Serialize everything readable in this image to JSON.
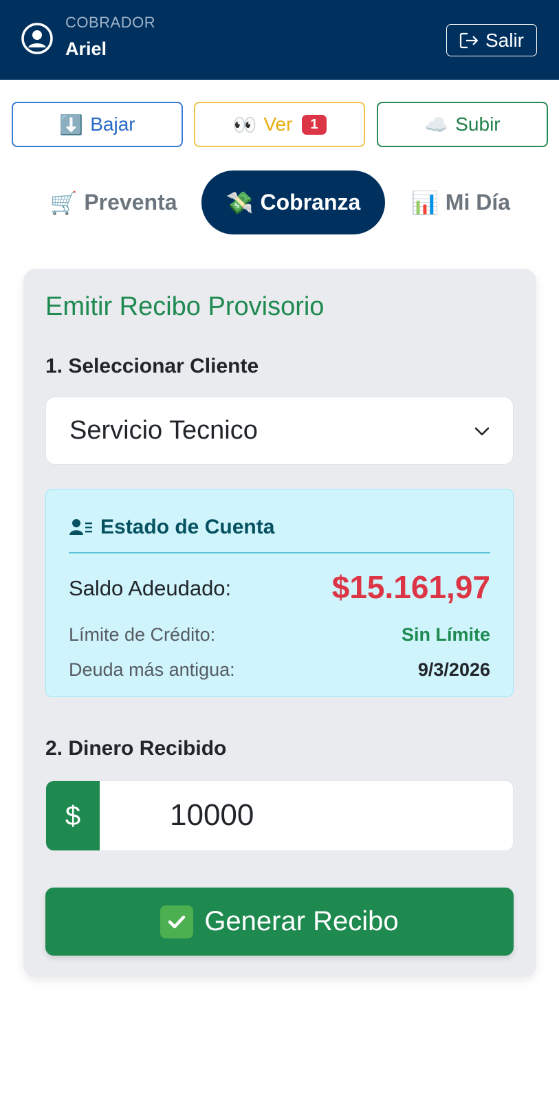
{
  "header": {
    "role_label": "COBRADOR",
    "user_name": "Ariel",
    "logout_label": "Salir"
  },
  "actions": {
    "download": {
      "icon": "⬇️",
      "label": "Bajar"
    },
    "view": {
      "icon": "👀",
      "label": "Ver",
      "badge": "1"
    },
    "upload": {
      "icon": "☁️",
      "label": "Subir"
    }
  },
  "tabs": [
    {
      "icon": "🛒",
      "label": "Preventa",
      "active": false
    },
    {
      "icon": "💸",
      "label": "Cobranza",
      "active": true
    },
    {
      "icon": "📊",
      "label": "Mi Día",
      "active": false
    }
  ],
  "receipt": {
    "title": "Emitir Recibo Provisorio",
    "step1_label": "1. Seleccionar Cliente",
    "selected_client": "Servicio Tecnico",
    "account": {
      "title": "Estado de Cuenta",
      "balance_label": "Saldo Adeudado:",
      "balance_value": "$15.161,97",
      "credit_label": "Límite de Crédito:",
      "credit_value": "Sin Límite",
      "oldest_label": "Deuda más antigua:",
      "oldest_value": "9/3/2026"
    },
    "step2_label": "2. Dinero Recibido",
    "currency_symbol": "$",
    "amount_value": "10000",
    "generate_label": "Generar Recibo"
  },
  "colors": {
    "navy": "#00305e",
    "green": "#1e8a50",
    "red": "#dc3545",
    "info_bg": "#cff4fc"
  }
}
